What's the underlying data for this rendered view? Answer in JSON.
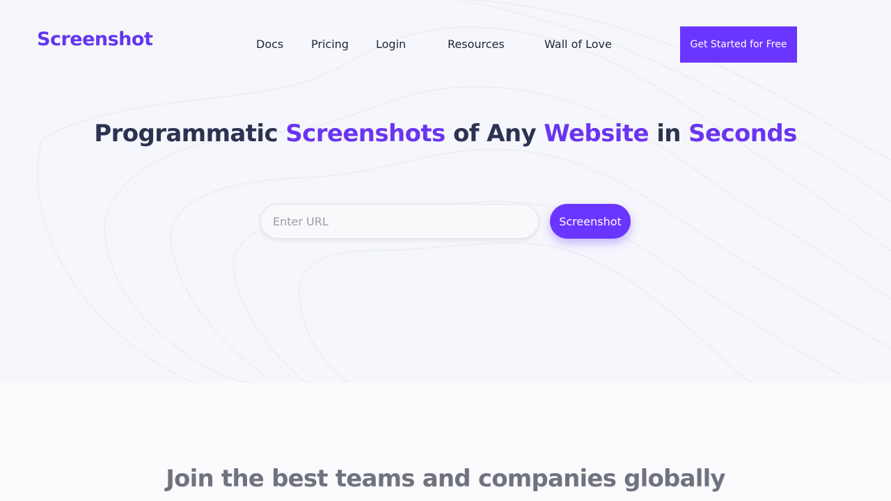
{
  "brand": {
    "logo_text": "Screenshot",
    "accent_color": "#6a35ff"
  },
  "nav": {
    "links": [
      "Docs",
      "Pricing",
      "Login",
      "Resources",
      "Wall of Love"
    ],
    "cta_label": "Get Started for Free"
  },
  "hero": {
    "headline_parts": {
      "p1": "Programmatic ",
      "a1": "Screenshots",
      "p2": " of Any ",
      "a2": "Website",
      "p3": " in ",
      "a3": "Seconds"
    },
    "url_placeholder": "Enter URL",
    "url_value": "",
    "button_label": "Screenshot"
  },
  "teams_section": {
    "heading": "Join the best teams and companies globally"
  }
}
